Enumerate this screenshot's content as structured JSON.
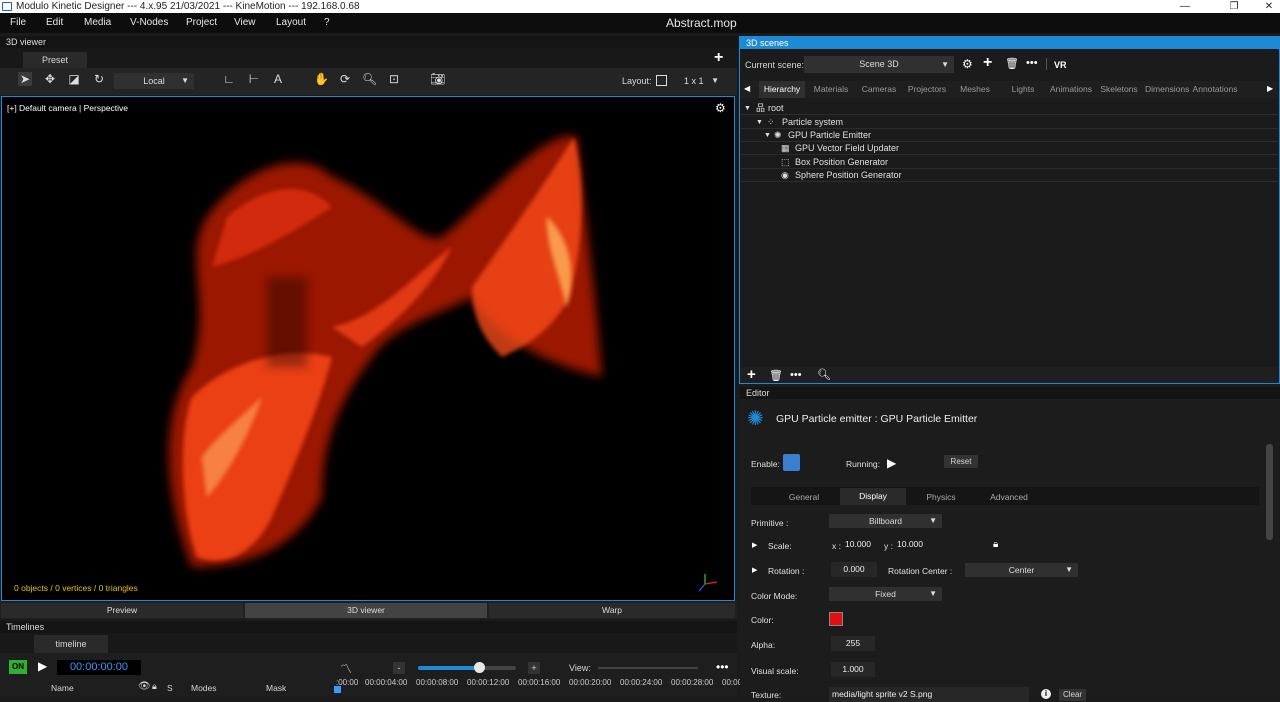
{
  "window": {
    "title": "Modulo Kinetic Designer --- 4.x.95 21/03/2021 --- KineMotion --- 192.168.0.68",
    "document": "Abstract.mop"
  },
  "menu": [
    "File",
    "Edit",
    "Media",
    "V-Nodes",
    "Project",
    "View",
    "Layout",
    "?"
  ],
  "viewer": {
    "panel_title": "3D viewer",
    "tab": "Preset",
    "coord_mode": "Local",
    "layout_label": "Layout:",
    "layout_value": "1 x 1",
    "camera_label": "[+] Default camera | Perspective",
    "stats": "0 objects / 0 vertices / 0 triangles",
    "bottom_tabs": [
      "Preview",
      "3D viewer",
      "Warp"
    ],
    "active_bottom_tab": "3D viewer"
  },
  "timelines": {
    "panel_title": "Timelines",
    "tab": "timeline",
    "on_label": "ON",
    "timecode": "00:00:00:00",
    "view_label": "View:",
    "minus": "-",
    "plus": "+",
    "zoom_level": 0.62,
    "columns": {
      "name": "Name",
      "s": "S",
      "modes": "Modes",
      "mask": "Mask"
    },
    "ruler": [
      ":00:00",
      "00:00:04:00",
      "00:00:08:00",
      "00:00:12:00",
      "00:00:16:00",
      "00:00:20:00",
      "00:00:24:00",
      "00:00:28:00",
      "00:00:"
    ]
  },
  "scenes": {
    "panel_title": "3D scenes",
    "current_scene_label": "Current scene:",
    "current_scene": "Scene 3D",
    "vr_label": "VR",
    "tabs": [
      "Hierarchy",
      "Materials",
      "Cameras",
      "Projectors",
      "Meshes",
      "Lights",
      "Animations",
      "Skeletons",
      "Dimensions",
      "Annotations"
    ],
    "active_tab": "Hierarchy",
    "tree": [
      {
        "label": "root",
        "icon": "hierarchy-icon"
      },
      {
        "label": "Particle system",
        "icon": "particles-icon"
      },
      {
        "label": "GPU Particle Emitter",
        "icon": "emitter-icon"
      },
      {
        "label": "GPU Vector Field Updater",
        "icon": "grid-icon"
      },
      {
        "label": "Box Position Generator",
        "icon": "box-icon"
      },
      {
        "label": "Sphere Position Generator",
        "icon": "sphere-icon"
      }
    ]
  },
  "editor": {
    "panel_title": "Editor",
    "heading": "GPU Particle emitter : GPU Particle Emitter",
    "enable_label": "Enable:",
    "running_label": "Running:",
    "reset_label": "Reset",
    "tabs": [
      "General",
      "Display",
      "Physics",
      "Advanced"
    ],
    "active_tab": "Display",
    "primitive_label": "Primitive :",
    "primitive_value": "Billboard",
    "scale_label": "Scale:",
    "scale_x_label": "x :",
    "scale_x": "10.000",
    "scale_y_label": "y :",
    "scale_y": "10.000",
    "rotation_label": "Rotation :",
    "rotation_value": "0.000",
    "rotation_center_label": "Rotation Center :",
    "rotation_center_value": "Center",
    "color_mode_label": "Color Mode:",
    "color_mode_value": "Fixed",
    "color_label": "Color:",
    "color_value": "#e01010",
    "alpha_label": "Alpha:",
    "alpha_value": "255",
    "visual_scale_label": "Visual scale:",
    "visual_scale_value": "1.000",
    "texture_label": "Texture:",
    "texture_value": "media/light sprite v2 S.png",
    "clear_label": "Clear"
  },
  "colors": {
    "accent": "#1e8ad6",
    "enable_checkbox": "#3a7fd0",
    "on_green": "#2fb12f",
    "timecode": "#3a9bff",
    "stats_text": "#e6c200",
    "particles": "#ff3a10"
  }
}
